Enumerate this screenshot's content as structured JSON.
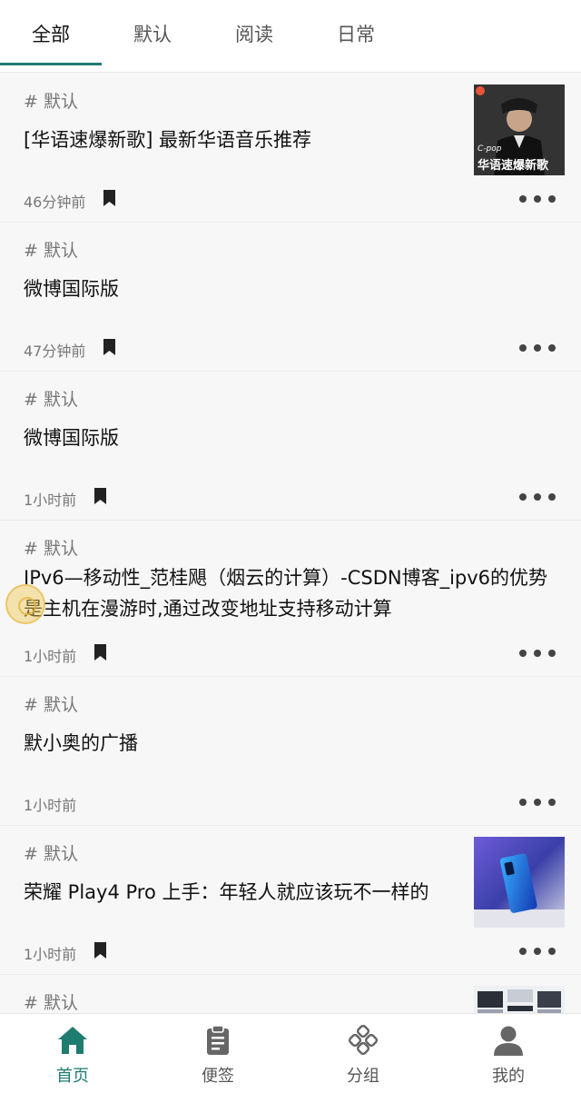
{
  "tabs": [
    {
      "label": "全部",
      "active": true
    },
    {
      "label": "默认",
      "active": false
    },
    {
      "label": "阅读",
      "active": false
    },
    {
      "label": "日常",
      "active": false
    }
  ],
  "feed": [
    {
      "tag": "# 默认",
      "title": "[华语速爆新歌] 最新华语音乐推荐",
      "time": "46分钟前",
      "bookmarked": true,
      "thumb": {
        "type": "album",
        "small_text": "C-pop",
        "big_text": "华语速爆新歌"
      }
    },
    {
      "tag": "# 默认",
      "title": "微博国际版",
      "time": "47分钟前",
      "bookmarked": true
    },
    {
      "tag": "# 默认",
      "title": "微博国际版",
      "time": "1小时前",
      "bookmarked": true
    },
    {
      "tag": "# 默认",
      "title": "IPv6—移动性_范桂飓（烟云的计算）-CSDN博客_ipv6的优势是主机在漫游时,通过改变地址支持移动计算",
      "time": "1小时前",
      "bookmarked": true
    },
    {
      "tag": "# 默认",
      "title": "默小奥的广播",
      "time": "1小时前",
      "bookmarked": false
    },
    {
      "tag": "# 默认",
      "title": "荣耀 Play4 Pro 上手：年轻人就应该玩不一样的",
      "time": "1小时前",
      "bookmarked": true,
      "thumb": {
        "type": "phone"
      }
    },
    {
      "tag": "# 默认",
      "title": "",
      "time": "",
      "bookmarked": false,
      "thumb": {
        "type": "laptops"
      }
    }
  ],
  "bottom_nav": [
    {
      "label": "首页",
      "icon": "home-icon",
      "active": true
    },
    {
      "label": "便签",
      "icon": "clipboard-icon",
      "active": false
    },
    {
      "label": "分组",
      "icon": "group-icon",
      "active": false
    },
    {
      "label": "我的",
      "icon": "person-icon",
      "active": false
    }
  ],
  "colors": {
    "accent": "#1f7c70",
    "text": "#111111",
    "muted": "#777777",
    "background": "#f7f7f7"
  }
}
